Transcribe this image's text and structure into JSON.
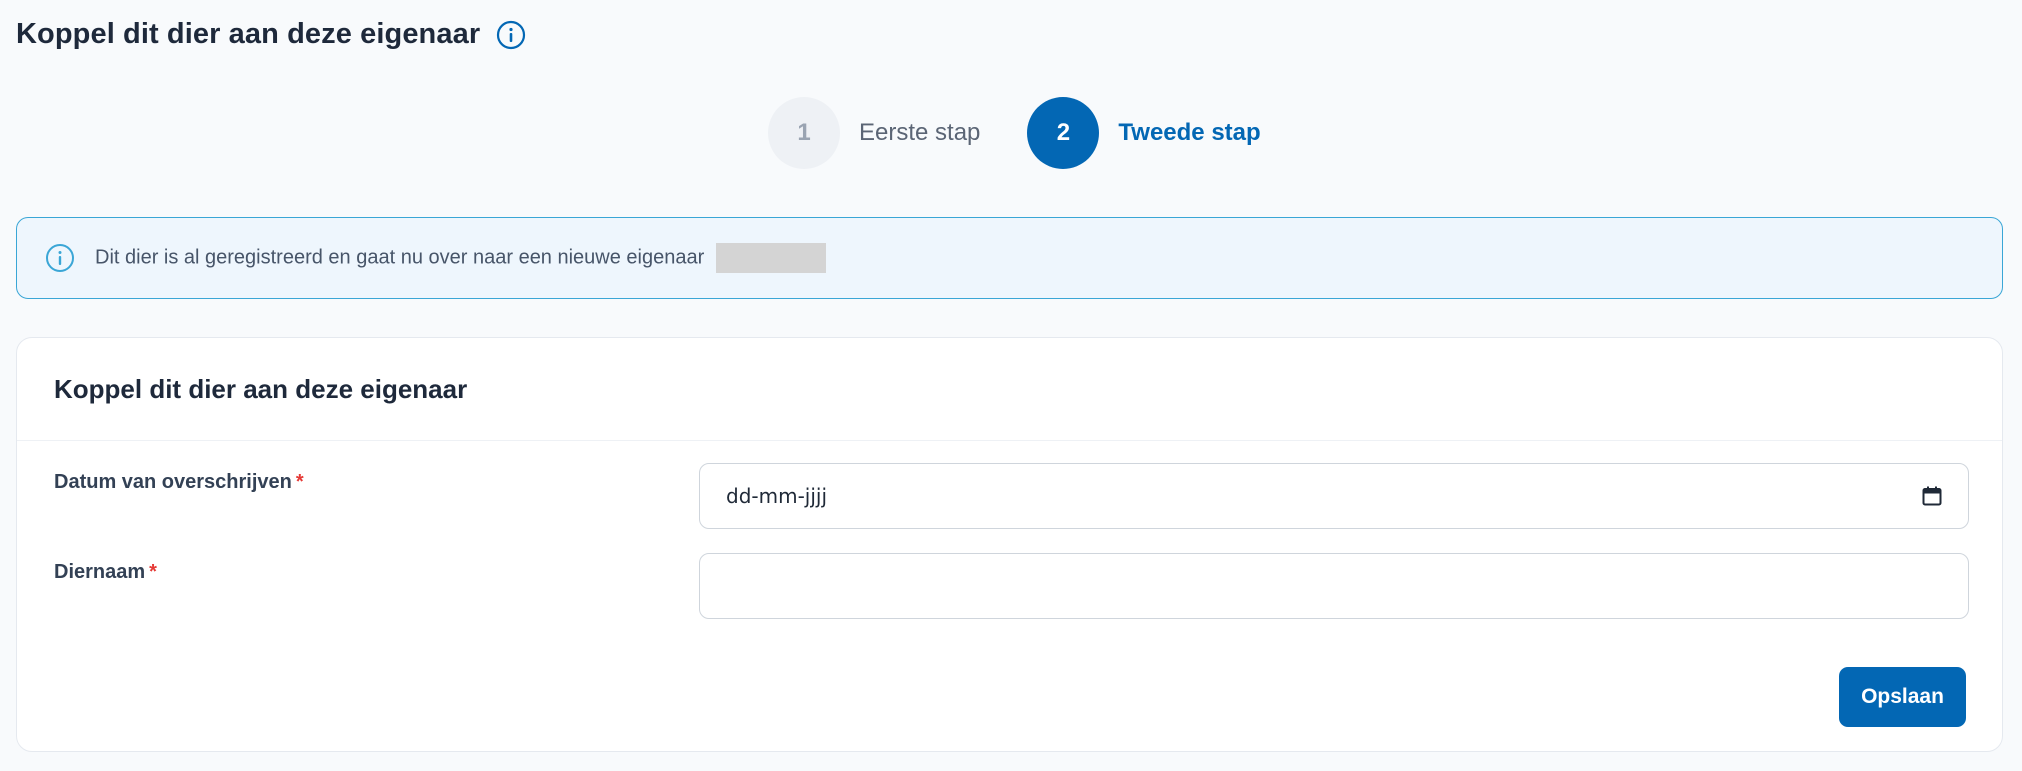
{
  "page": {
    "title": "Koppel dit dier aan deze eigenaar"
  },
  "stepper": {
    "steps": [
      {
        "number": "1",
        "label": "Eerste stap",
        "state": "inactive"
      },
      {
        "number": "2",
        "label": "Tweede stap",
        "state": "active"
      }
    ]
  },
  "alert": {
    "text": "Dit dier is al geregistreerd en gaat nu over naar een nieuwe eigenaar",
    "icon": "info-icon"
  },
  "form": {
    "title": "Koppel dit dier aan deze eigenaar",
    "fields": [
      {
        "label": "Datum van overschrijven",
        "required_mark": "*",
        "value": "dd-mm-jjjj",
        "icon": "calendar-icon"
      },
      {
        "label": "Diernaam",
        "required_mark": "*",
        "value": ""
      }
    ],
    "save_label": "Opslaan"
  },
  "colors": {
    "primary": "#0367b4",
    "alert_border": "#3aa6d6",
    "alert_bg": "#eef6fd",
    "required": "#e53935",
    "page_bg": "#f8fafc"
  }
}
